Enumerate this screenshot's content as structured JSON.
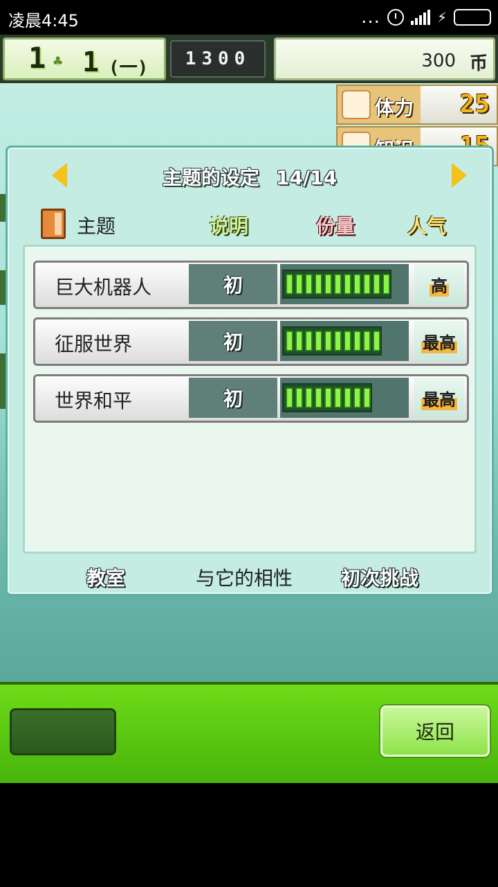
{
  "status_bar": {
    "time": "凌晨4:45",
    "dots": "...",
    "bolt": "⚡"
  },
  "top_bar": {
    "year": "1",
    "month": "1",
    "weekday": "(一)",
    "clock": "1300",
    "money": "300",
    "money_unit": "币"
  },
  "stats": [
    {
      "label": "体力",
      "value": "25"
    },
    {
      "label": "知识",
      "value": "15"
    }
  ],
  "panel": {
    "title": "主题的设定",
    "counter": "14/14",
    "headers": {
      "topic": "主题",
      "desc": "说明",
      "amount": "份量",
      "popularity": "人气"
    },
    "rows": [
      {
        "name": "巨大机器人",
        "level": "初",
        "bar_segments": 11,
        "popularity": "高"
      },
      {
        "name": "征服世界",
        "level": "初",
        "bar_segments": 10,
        "popularity": "最高"
      },
      {
        "name": "世界和平",
        "level": "初",
        "bar_segments": 9,
        "popularity": "最高"
      }
    ],
    "tabs": {
      "classroom": "教室",
      "compat": "与它的相性",
      "first": "初次挑战"
    }
  },
  "bottom": {
    "back_label": "返回"
  },
  "colors": {
    "accent_yellow": "#f3c21b",
    "bar_green": "#8df547",
    "bottom_green": "#5fcc12"
  }
}
